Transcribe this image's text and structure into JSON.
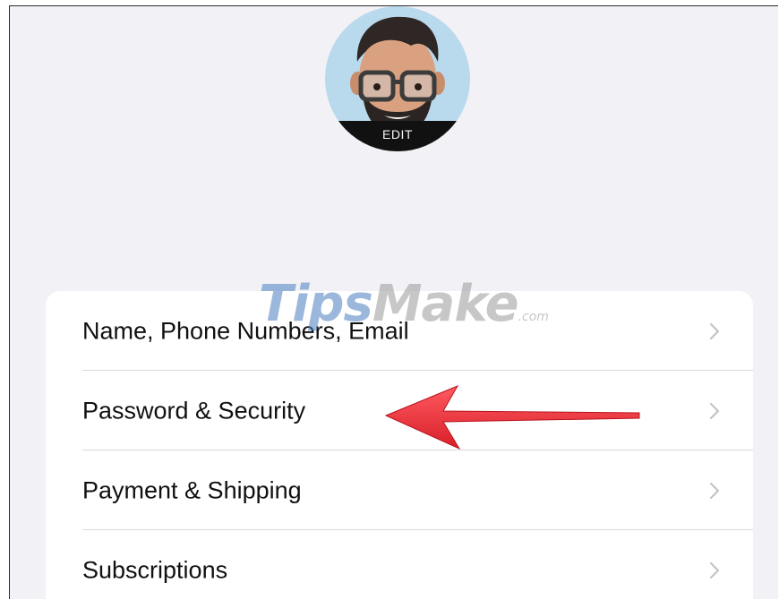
{
  "profile": {
    "edit_label": "EDIT"
  },
  "menu": {
    "items": [
      {
        "label": "Name, Phone Numbers, Email"
      },
      {
        "label": "Password & Security"
      },
      {
        "label": "Payment & Shipping"
      },
      {
        "label": "Subscriptions"
      }
    ]
  },
  "watermark": {
    "brand_part1": "Tips",
    "brand_part2": "Make",
    "suffix": ".com"
  },
  "icons": {
    "row_chevron": "chevron-right-icon",
    "annotation": "red-arrow-left"
  },
  "colors": {
    "background": "#f2f1f6",
    "card": "#ffffff",
    "chevron": "#c4c4c7",
    "annotation_arrow": "#e8343d"
  }
}
